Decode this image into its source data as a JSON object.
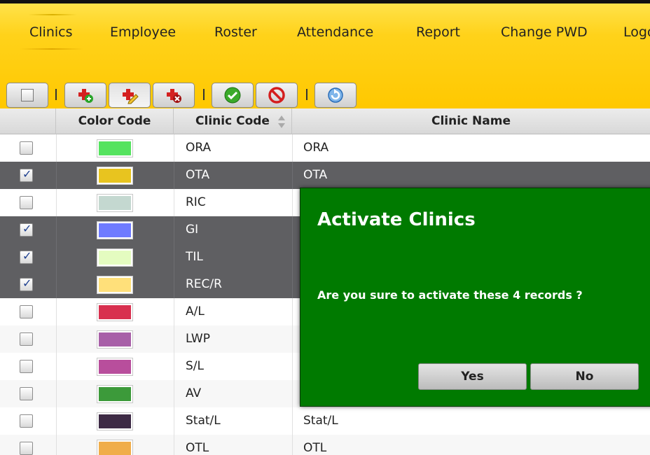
{
  "nav": {
    "items": [
      {
        "label": "Clinics"
      },
      {
        "label": "Employee"
      },
      {
        "label": "Roster"
      },
      {
        "label": "Attendance"
      },
      {
        "label": "Report"
      },
      {
        "label": "Change PWD"
      },
      {
        "label": "Logout"
      }
    ],
    "active": "Clinics"
  },
  "toolbar": {
    "buttons": [
      "select-all",
      "add",
      "edit",
      "delete",
      "activate",
      "deactivate",
      "refresh"
    ]
  },
  "table": {
    "columns": [
      "Color Code",
      "Clinic Code",
      "Clinic Name"
    ],
    "rows": [
      {
        "checked": false,
        "color": "#55e35f",
        "code": "ORA",
        "name": "ORA",
        "selected": false
      },
      {
        "checked": true,
        "color": "#e8c41f",
        "code": "OTA",
        "name": "OTA",
        "selected": true
      },
      {
        "checked": false,
        "color": "#c4d8d0",
        "code": "RIC",
        "name": "",
        "selected": false
      },
      {
        "checked": true,
        "color": "#6f7bff",
        "code": "GI",
        "name": "",
        "selected": true
      },
      {
        "checked": true,
        "color": "#e4fcc0",
        "code": "TIL",
        "name": "",
        "selected": true
      },
      {
        "checked": true,
        "color": "#ffe07a",
        "code": "REC/R",
        "name": "",
        "selected": true
      },
      {
        "checked": false,
        "color": "#d8304f",
        "code": "A/L",
        "name": "",
        "selected": false
      },
      {
        "checked": false,
        "color": "#a860a8",
        "code": "LWP",
        "name": "",
        "selected": false
      },
      {
        "checked": false,
        "color": "#b84e9c",
        "code": "S/L",
        "name": "",
        "selected": false
      },
      {
        "checked": false,
        "color": "#3c9a3a",
        "code": "AV",
        "name": "",
        "selected": false
      },
      {
        "checked": false,
        "color": "#3d2a45",
        "code": "Stat/L",
        "name": "Stat/L",
        "selected": false
      },
      {
        "checked": false,
        "color": "#f0ad4a",
        "code": "OTL",
        "name": "OTL",
        "selected": false
      }
    ]
  },
  "dialog": {
    "title": "Activate Clinics",
    "message": "Are you sure to activate these 4 records ?",
    "yes_label": "Yes",
    "no_label": "No"
  },
  "colors": {
    "header_yellow": "#ffc800",
    "dialog_green": "#007a00",
    "selected_row": "#5f5f62"
  }
}
